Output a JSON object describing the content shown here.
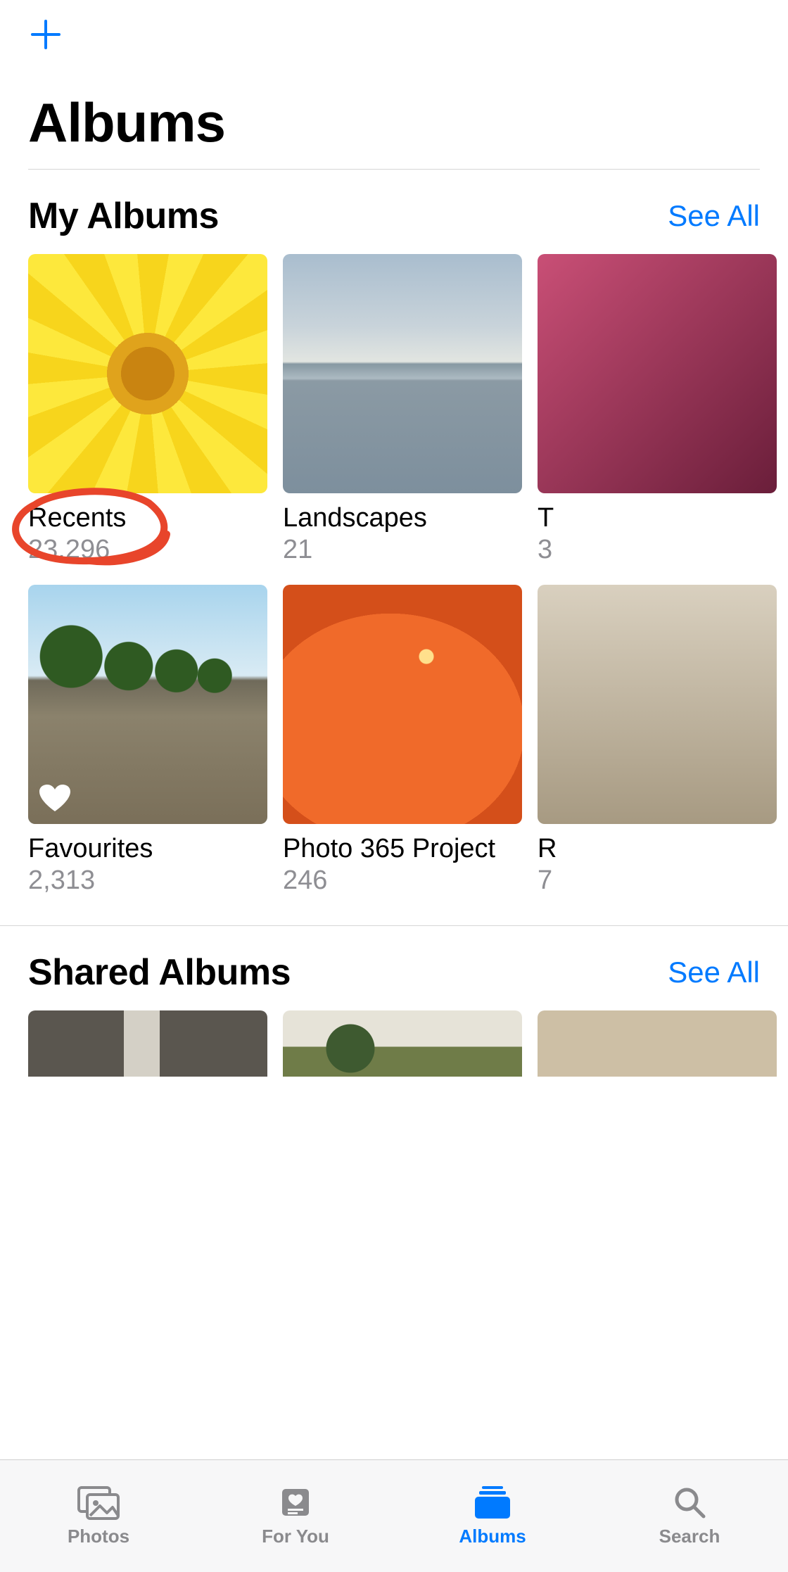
{
  "header": {
    "page_title": "Albums"
  },
  "sections": {
    "my_albums": {
      "title": "My Albums",
      "see_all": "See All",
      "rows": [
        [
          {
            "name": "Recents",
            "count": "23,296",
            "annotated": true
          },
          {
            "name": "Landscapes",
            "count": "21"
          },
          {
            "name_partial": "T",
            "count_partial": "3"
          }
        ],
        [
          {
            "name": "Favourites",
            "count": "2,313",
            "heart_overlay": true
          },
          {
            "name": "Photo 365 Project",
            "count": "246"
          },
          {
            "name_partial": "R",
            "count_partial": "7"
          }
        ]
      ]
    },
    "shared_albums": {
      "title": "Shared Albums",
      "see_all": "See All"
    }
  },
  "tabbar": {
    "items": [
      {
        "label": "Photos",
        "icon": "photos-icon",
        "active": false
      },
      {
        "label": "For You",
        "icon": "foryou-icon",
        "active": false
      },
      {
        "label": "Albums",
        "icon": "albums-icon",
        "active": true
      },
      {
        "label": "Search",
        "icon": "search-icon",
        "active": false
      }
    ]
  },
  "colors": {
    "accent": "#007aff",
    "text_secondary": "#8e8e93",
    "annotation": "#e8452b"
  }
}
